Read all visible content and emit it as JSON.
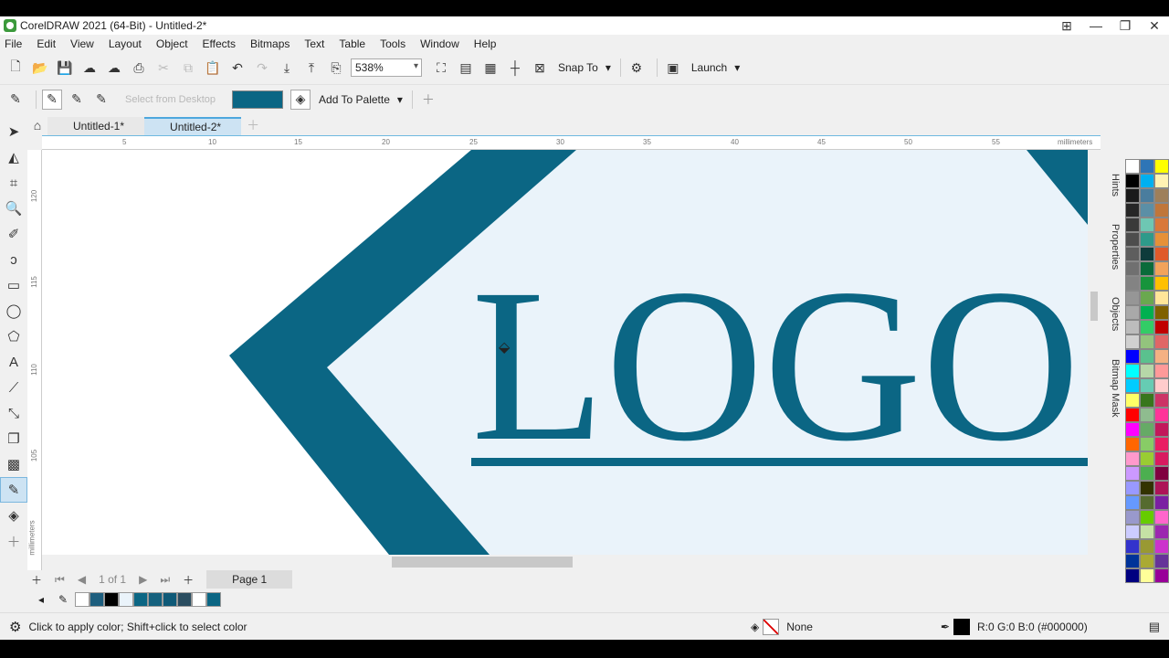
{
  "window": {
    "title": "CorelDRAW 2021 (64-Bit) - Untitled-2*"
  },
  "menu": [
    "File",
    "Edit",
    "View",
    "Layout",
    "Object",
    "Effects",
    "Bitmaps",
    "Text",
    "Table",
    "Tools",
    "Window",
    "Help"
  ],
  "toolbar": {
    "zoom": "538%",
    "snap_label": "Snap To",
    "launch_label": "Launch"
  },
  "propbar": {
    "select_desktop": "Select from Desktop",
    "add_palette": "Add To Palette",
    "color": "#0b6684"
  },
  "tabs": [
    "Untitled-1*",
    "Untitled-2*"
  ],
  "ruler": {
    "h_labels": [
      "5",
      "10",
      "15",
      "20",
      "25",
      "30",
      "35",
      "40",
      "45",
      "50",
      "55"
    ],
    "h_unit": "millimeters",
    "v_labels": [
      "120",
      "115",
      "110",
      "105"
    ],
    "v_unit": "millimeters"
  },
  "artwork": {
    "text": "LOGO",
    "fill": "#0b6684",
    "bg": "#eaf3fa"
  },
  "pagenav": {
    "count": "1 of 1",
    "page": "Page 1"
  },
  "dockers": [
    "Hints",
    "Properties",
    "Objects",
    "Bitmap Mask"
  ],
  "status": {
    "hint": "Click to apply color; Shift+click to select color",
    "fill": "None",
    "outline": "R:0 G:0 B:0 (#000000)"
  },
  "doc_palette": [
    "#ffffff",
    "#1d5e7e",
    "#000000",
    "#eaf3fa",
    "#0b6684",
    "#15617e",
    "#0f5a78",
    "#2a4d60",
    "#ffffff",
    "#0b6684"
  ],
  "palette": [
    "#ffffff",
    "#2e75b6",
    "#ffff00",
    "#000000",
    "#00b0f0",
    "#fff2b3",
    "#1a1a1a",
    "#4a7d9e",
    "#9e7f5a",
    "#262626",
    "#5b8fa6",
    "#c0763a",
    "#3a3a3a",
    "#6ec7b3",
    "#d9783a",
    "#4d4d4d",
    "#2e9a8a",
    "#e69138",
    "#5e5e5e",
    "#0e3b3b",
    "#e05a2a",
    "#707070",
    "#0a6b3a",
    "#f2a35b",
    "#838383",
    "#17943c",
    "#ffc000",
    "#969696",
    "#6aa84f",
    "#ffe599",
    "#a9a9a9",
    "#00b050",
    "#7f6000",
    "#bcbcbc",
    "#33cc66",
    "#c00000",
    "#d0d0d0",
    "#93c47d",
    "#e06666",
    "#0000ff",
    "#5ac18e",
    "#f4b183",
    "#00ffff",
    "#b6d7a8",
    "#ff9999",
    "#00ccff",
    "#66ccb3",
    "#ffcccc",
    "#ffff66",
    "#38761d",
    "#cc3366",
    "#ff0000",
    "#8fbc8f",
    "#ff3399",
    "#ff00ff",
    "#66aa66",
    "#c2185b",
    "#ff6600",
    "#88cc66",
    "#e91e63",
    "#ff99cc",
    "#99cc33",
    "#d81b60",
    "#cc99ff",
    "#4caf50",
    "#800040",
    "#9999ff",
    "#333300",
    "#ad1457",
    "#6699ff",
    "#556b2f",
    "#7b1fa2",
    "#9999cc",
    "#66cc00",
    "#ff66cc",
    "#ccccff",
    "#c5e1a5",
    "#9c27b0",
    "#3333cc",
    "#999933",
    "#cc33cc",
    "#003399",
    "#aaaa33",
    "#663399",
    "#000080",
    "#ffff99",
    "#990099"
  ]
}
